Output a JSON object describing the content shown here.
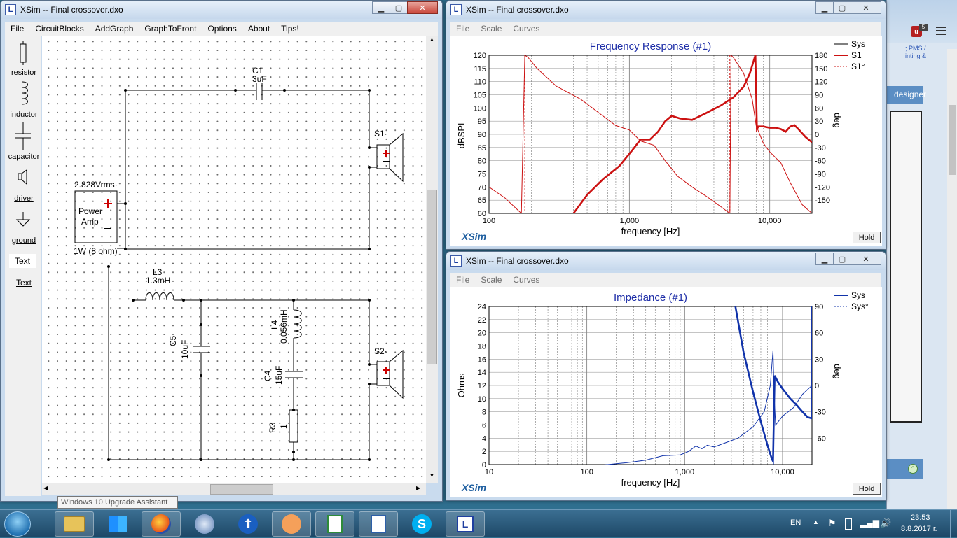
{
  "circuit_window": {
    "title": "XSim -- Final crossover.dxo",
    "menu": [
      "File",
      "CircuitBlocks",
      "AddGraph",
      "GraphToFront",
      "Options",
      "About",
      "Tips!"
    ],
    "toolbox": [
      {
        "label": "resistor",
        "icon": "resistor-icon"
      },
      {
        "label": "inductor",
        "icon": "inductor-icon"
      },
      {
        "label": "capacitor",
        "icon": "capacitor-icon"
      },
      {
        "label": "driver",
        "icon": "speaker-icon"
      },
      {
        "label": "ground",
        "icon": "ground-icon"
      },
      {
        "label": "Text",
        "icon": "text-icon"
      },
      {
        "label": "Text",
        "icon": "text-link"
      }
    ],
    "components": {
      "c1_name": "C1",
      "c1_value": "3uF",
      "s1_name": "S1·",
      "s2_name": "S2·",
      "source_voltage": "2.828Vrms·",
      "source_line1": "Power",
      "source_line2": "Amp",
      "source_load": "1W (8 ohm)",
      "l3_name": "L3",
      "l3_value": "1.3mH",
      "c5_name": "C5",
      "c5_value": "10uF",
      "l4_name": "L4",
      "l4_value": "0.056mH",
      "c4_name": "C4",
      "c4_value": "15uF",
      "r3_name": "R3",
      "r3_value": "1"
    },
    "tooltip": "Windows 10 Upgrade Assistant"
  },
  "freq_window": {
    "title": "XSim -- Final crossover.dxo",
    "menu": [
      "File",
      "Scale",
      "Curves"
    ],
    "brand": "XSim",
    "hold": "Hold"
  },
  "imp_window": {
    "title": "XSim -- Final crossover.dxo",
    "menu": [
      "File",
      "Scale",
      "Curves"
    ],
    "brand": "XSim",
    "hold": "Hold"
  },
  "background_window": {
    "tab_text": "designer",
    "partial_text1": "; PMS /",
    "partial_text2": "inting &"
  },
  "taskbar": {
    "lang": "EN",
    "time": "23:53",
    "date": "8.8.2017 г."
  },
  "colors": {
    "accent": "#1f2fa8",
    "red": "#cc1111",
    "blue": "#1133aa"
  },
  "chart_data": [
    {
      "type": "line",
      "title": "Frequency Response (#1)",
      "xlabel": "frequency [Hz]",
      "ylabel": "dBSPL",
      "y2label": "deg",
      "xscale": "log",
      "xlim": [
        100,
        20000
      ],
      "ylim": [
        60,
        120
      ],
      "y2lim": [
        -180,
        180
      ],
      "xticks": [
        {
          "v": 100,
          "label": "100"
        },
        {
          "v": 1000,
          "label": "1,000"
        },
        {
          "v": 10000,
          "label": "10,000"
        }
      ],
      "yticks": [
        60,
        65,
        70,
        75,
        80,
        85,
        90,
        95,
        100,
        105,
        110,
        115,
        120
      ],
      "y2ticks": [
        -150,
        -120,
        -90,
        -60,
        -30,
        0,
        30,
        60,
        90,
        120,
        150,
        180
      ],
      "grid": true,
      "legend_position": "top-right",
      "series": [
        {
          "name": "Sys",
          "color": "#000000",
          "style": "solid",
          "axis": "left",
          "x": [],
          "y": []
        },
        {
          "name": "S1",
          "color": "#cc1111",
          "style": "thick",
          "axis": "left",
          "x": [
            400,
            500,
            650,
            850,
            1050,
            1200,
            1400,
            1600,
            1800,
            2000,
            2300,
            2800,
            3500,
            4500,
            5500,
            6500,
            7200,
            7700,
            7900,
            8000,
            8100,
            8300,
            9000,
            10000,
            11000,
            12000,
            13000,
            14000,
            15000,
            16000,
            18000,
            20000
          ],
          "y": [
            60,
            67,
            73,
            78,
            84,
            88,
            88,
            91,
            95,
            97,
            96,
            95.5,
            98,
            101,
            104,
            108,
            113,
            118,
            120,
            106,
            92,
            93,
            93,
            92.5,
            92.5,
            92,
            91,
            93,
            93.5,
            92,
            89,
            87
          ]
        },
        {
          "name": "S1°",
          "color": "#cc1111",
          "style": "thin",
          "axis": "right",
          "x": [
            100,
            130,
            170,
            180,
            190,
            220,
            300,
            450,
            600,
            800,
            1000,
            1200,
            1500,
            1800,
            2200,
            2800,
            3500,
            4500,
            5200,
            5300,
            5500,
            6500,
            7500,
            8000,
            9000,
            10000,
            12000,
            14000,
            17000,
            20000
          ],
          "y": [
            -120,
            -145,
            -180,
            180,
            175,
            150,
            110,
            80,
            50,
            20,
            10,
            -15,
            -25,
            -60,
            -95,
            -120,
            -140,
            -165,
            -180,
            180,
            175,
            140,
            80,
            20,
            -20,
            -40,
            -65,
            -110,
            -160,
            -180
          ]
        }
      ]
    },
    {
      "type": "line",
      "title": "Impedance (#1)",
      "xlabel": "frequency [Hz]",
      "ylabel": "Ohms",
      "y2label": "deg",
      "xscale": "log",
      "xlim": [
        10,
        20000
      ],
      "ylim": [
        0,
        24
      ],
      "y2lim": [
        -90,
        90
      ],
      "xticks": [
        {
          "v": 10,
          "label": "10"
        },
        {
          "v": 100,
          "label": "100"
        },
        {
          "v": 1000,
          "label": "1,000"
        },
        {
          "v": 10000,
          "label": "10,000"
        }
      ],
      "yticks": [
        0,
        2,
        4,
        6,
        8,
        10,
        12,
        14,
        16,
        18,
        20,
        22,
        24
      ],
      "y2ticks": [
        -60,
        -30,
        0,
        30,
        60,
        90
      ],
      "grid": true,
      "legend_position": "top-right",
      "series": [
        {
          "name": "Sys",
          "color": "#1133aa",
          "style": "thick",
          "axis": "left",
          "x": [
            3300,
            4000,
            5000,
            6000,
            7000,
            7800,
            8000,
            8300,
            9000,
            10000,
            12000,
            14000,
            16000,
            18000,
            20000,
            20000
          ],
          "y": [
            24,
            17,
            11,
            6.5,
            3,
            0.8,
            0.5,
            13.5,
            12.5,
            11.5,
            10,
            9,
            8,
            7.2,
            7,
            24
          ]
        },
        {
          "name": "Sys°",
          "color": "#1133aa",
          "style": "thin",
          "axis": "right",
          "x": [
            130,
            250,
            400,
            600,
            900,
            1100,
            1300,
            1500,
            1700,
            2000,
            2500,
            3500,
            5000,
            6500,
            7500,
            8000,
            8200,
            8500,
            10000,
            13000,
            16000,
            20000
          ],
          "y": [
            -91,
            -88,
            -85,
            -80,
            -79,
            -75,
            -69,
            -72,
            -68,
            -70,
            -66,
            -60,
            -47,
            -30,
            0,
            40,
            -10,
            -45,
            -35,
            -25,
            -10,
            0
          ]
        }
      ]
    }
  ]
}
